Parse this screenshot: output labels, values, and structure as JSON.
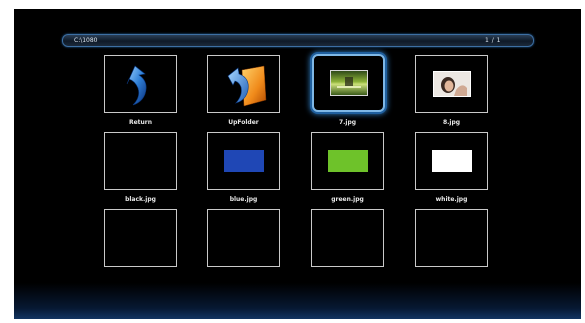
{
  "pathbar": {
    "path": "C:\\1080",
    "page": "1 / 1"
  },
  "items": [
    {
      "label": "Return",
      "kind": "return-icon"
    },
    {
      "label": "UpFolder",
      "kind": "folder-up-icon"
    },
    {
      "label": "7.jpg",
      "kind": "image-thumbnail",
      "selected": true
    },
    {
      "label": "8.jpg",
      "kind": "image-thumbnail"
    },
    {
      "label": "black.jpg",
      "kind": "color-swatch",
      "color": "#000000"
    },
    {
      "label": "blue.jpg",
      "kind": "color-swatch",
      "color": "#1f47b5"
    },
    {
      "label": "green.jpg",
      "kind": "color-swatch",
      "color": "#6ec22a"
    },
    {
      "label": "white.jpg",
      "kind": "color-swatch",
      "color": "#ffffff"
    },
    {
      "label": "",
      "kind": "empty"
    },
    {
      "label": "",
      "kind": "empty"
    },
    {
      "label": "",
      "kind": "empty"
    },
    {
      "label": "",
      "kind": "empty"
    }
  ],
  "colors": {
    "accent": "#2f7dc4",
    "background": "#000000"
  }
}
